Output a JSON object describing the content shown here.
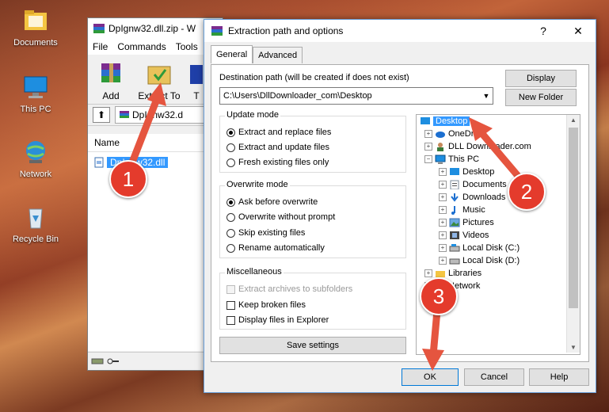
{
  "desktop": {
    "icons": [
      {
        "label": "Documents"
      },
      {
        "label": "This PC"
      },
      {
        "label": "Network"
      },
      {
        "label": "Recycle Bin"
      }
    ]
  },
  "winrar": {
    "title": "DpIgnw32.dll.zip - W",
    "menu": [
      "File",
      "Commands",
      "Tools"
    ],
    "toolbar": {
      "add": "Add",
      "extract": "Extract To",
      "test": "T"
    },
    "address": "DpIgnw32.d",
    "column_name": "Name",
    "file": "DpIgnw32.dll"
  },
  "dialog": {
    "title": "Extraction path and options",
    "help_btn": "?",
    "close_btn": "✕",
    "tabs": [
      "General",
      "Advanced"
    ],
    "dest_label": "Destination path (will be created if does not exist)",
    "dest_value": "C:\\Users\\DllDownloader_com\\Desktop",
    "display_btn": "Display",
    "new_folder_btn": "New Folder",
    "update_mode": {
      "title": "Update mode",
      "options": [
        "Extract and replace files",
        "Extract and update files",
        "Fresh existing files only"
      ]
    },
    "overwrite_mode": {
      "title": "Overwrite mode",
      "options": [
        "Ask before overwrite",
        "Overwrite without prompt",
        "Skip existing files",
        "Rename automatically"
      ]
    },
    "misc": {
      "title": "Miscellaneous",
      "options": [
        "Extract archives to subfolders",
        "Keep broken files",
        "Display files in Explorer"
      ]
    },
    "save_btn": "Save settings",
    "tree": {
      "items": [
        "Desktop",
        "OneDrive",
        "DLL Downloader.com",
        "This PC",
        "Desktop",
        "Documents",
        "Downloads",
        "Music",
        "Pictures",
        "Videos",
        "Local Disk (C:)",
        "Local Disk (D:)",
        "Libraries",
        "Network"
      ]
    },
    "ok_btn": "OK",
    "cancel_btn": "Cancel",
    "help_btn2": "Help"
  },
  "callouts": [
    "1",
    "2",
    "3"
  ],
  "colors": {
    "accent": "#3399ff",
    "callout": "#e43b2c",
    "callout_arrow": "#e5553f"
  }
}
